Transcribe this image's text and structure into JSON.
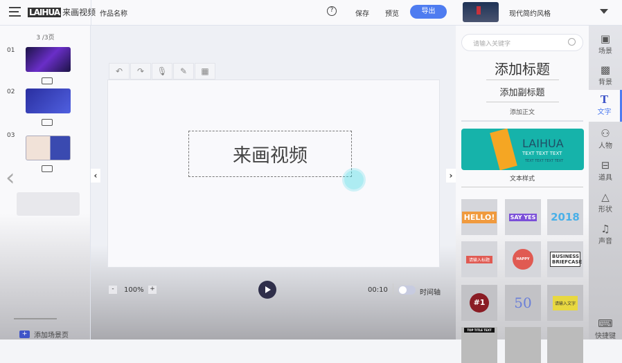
{
  "header": {
    "logo_en": "LAIHUA",
    "logo_cn": "来画视频",
    "project_name": "作品名称",
    "save": "保存",
    "preview": "预览",
    "export": "导出",
    "template_name": "现代简约风格"
  },
  "sidebar": {
    "page_indicator": "3 /3页",
    "scenes": [
      {
        "num": "01"
      },
      {
        "num": "02"
      },
      {
        "num": "03"
      }
    ],
    "add_scene": "添加场景页"
  },
  "canvas": {
    "text": "来画视频"
  },
  "bottom": {
    "zoom": "100%",
    "zoom_out": "-",
    "zoom_in": "+",
    "time": "00:10",
    "timeline_label": "时间轴",
    "timeline_on": false
  },
  "panel": {
    "search_placeholder": "请输入关键字",
    "add_title": "添加标题",
    "add_subtitle": "添加副标题",
    "add_body": "添加正文",
    "banner": {
      "title": "LAIHUA",
      "line1": "TEXT TEXT TEXT",
      "line2": "TEXT TEXT TEXT TEXT"
    },
    "styles_label": "文本样式",
    "tiles": [
      "HELLO!",
      "SAY YES",
      "2018",
      "请输入标题",
      "HAPPY",
      "BUSINESS BRIEFCASE",
      "#1",
      "50",
      "请输入文字",
      "TOP TITLE TEXT",
      "",
      ""
    ]
  },
  "tabs": [
    {
      "label": "场景",
      "icon": "grid-icon"
    },
    {
      "label": "背景",
      "icon": "checker-icon"
    },
    {
      "label": "文字",
      "icon": "text-icon"
    },
    {
      "label": "人物",
      "icon": "people-icon"
    },
    {
      "label": "道具",
      "icon": "briefcase-icon"
    },
    {
      "label": "形状",
      "icon": "shapes-icon"
    },
    {
      "label": "声音",
      "icon": "music-icon"
    },
    {
      "label": "快捷键",
      "icon": "keyboard-icon"
    }
  ],
  "colors": {
    "accent": "#4e7cf0",
    "play": "#2f2f4a",
    "banner": "#16b3aa"
  }
}
